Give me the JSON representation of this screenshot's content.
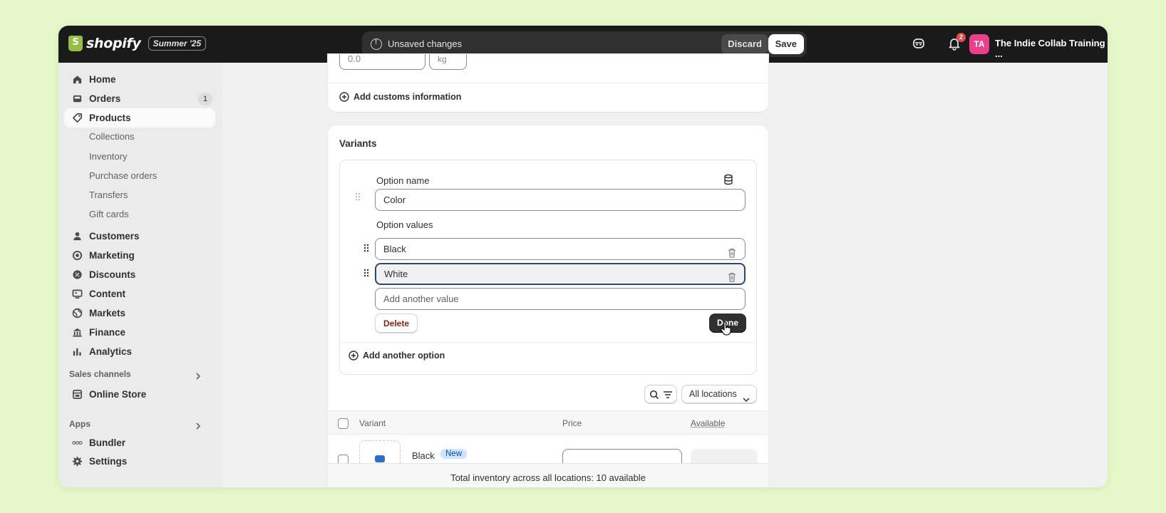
{
  "brand": {
    "name": "shopify",
    "edition": "Summer '25"
  },
  "save_bar": {
    "message": "Unsaved changes",
    "discard_label": "Discard",
    "save_label": "Save"
  },
  "header": {
    "notifications_count": "2",
    "avatar_initials": "TA",
    "store_name": "The Indie Collab Training ..."
  },
  "sidebar": {
    "items": [
      {
        "label": "Home"
      },
      {
        "label": "Orders",
        "count": "1"
      },
      {
        "label": "Products"
      },
      {
        "label": "Customers"
      },
      {
        "label": "Marketing"
      },
      {
        "label": "Discounts"
      },
      {
        "label": "Content"
      },
      {
        "label": "Markets"
      },
      {
        "label": "Finance"
      },
      {
        "label": "Analytics"
      }
    ],
    "product_subitems": [
      "Collections",
      "Inventory",
      "Purchase orders",
      "Transfers",
      "Gift cards"
    ],
    "sales_channels_label": "Sales channels",
    "online_store_label": "Online Store",
    "apps_label": "Apps",
    "bundler_label": "Bundler",
    "settings_label": "Settings"
  },
  "shipping": {
    "weight_value": "0.0",
    "weight_unit": "kg",
    "add_customs_label": "Add customs information"
  },
  "variants": {
    "title": "Variants",
    "option_name_label": "Option name",
    "option_name_value": "Color",
    "option_values_label": "Option values",
    "values": [
      "Black",
      "White"
    ],
    "add_value_placeholder": "Add another value",
    "delete_label": "Delete",
    "done_label": "Done",
    "add_option_label": "Add another option",
    "location_filter": "All locations",
    "table_headers": {
      "variant": "Variant",
      "price": "Price",
      "available": "Available"
    },
    "first_row": {
      "name": "Black",
      "badge": "New"
    },
    "total_inventory": "Total inventory across all locations: 10 available"
  },
  "colors": {
    "background": "#e6f8c9",
    "topbar": "#1a1a1a",
    "accent_avatar": "#e8418a",
    "danger_text": "#8e1f0b",
    "new_badge": "#cfe4ff"
  }
}
